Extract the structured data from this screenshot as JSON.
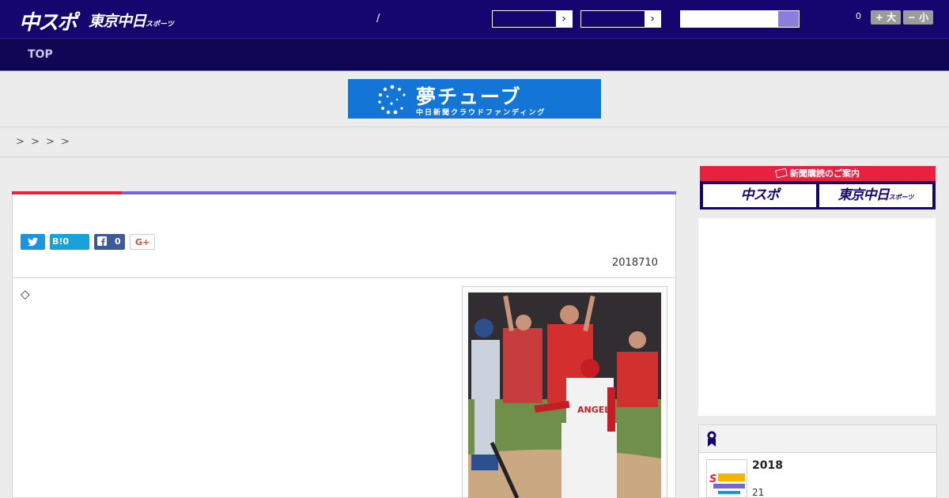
{
  "header": {
    "logo_primary": "中スポ",
    "logo_secondary": "東京中日",
    "logo_secondary_suffix": "スポーツ",
    "separator": "/",
    "select_arrow": "›",
    "notification_count": "0",
    "font_larger_label": "+ 大",
    "font_smaller_label": "− 小"
  },
  "nav": {
    "items": [
      {
        "label": "TOP"
      }
    ]
  },
  "banner": {
    "title": "夢チューブ",
    "subtitle": "中日新聞クラウドファンディング"
  },
  "breadcrumb": {
    "separators": [
      ">",
      ">",
      ">",
      ">"
    ]
  },
  "article": {
    "share": {
      "twitter_icon": "twitter-bird-icon",
      "hatena_label": "B!0",
      "facebook_count": "0",
      "gplus_label": "G+"
    },
    "date": "2018710",
    "lead_marker": "◇"
  },
  "sidebar": {
    "promo_header": "新聞購読のご案内",
    "promo_buttons": [
      {
        "label": "中スポ"
      },
      {
        "label": "東京中日",
        "suffix": "スポーツ"
      }
    ],
    "ranking": {
      "item_year": "2018",
      "item_count": "21"
    }
  },
  "colors": {
    "header_bg": "#15066f",
    "nav_bg": "#0f0654",
    "accent_red": "#e9203e",
    "accent_purple": "#7a66d0",
    "banner_blue": "#1376d6"
  }
}
